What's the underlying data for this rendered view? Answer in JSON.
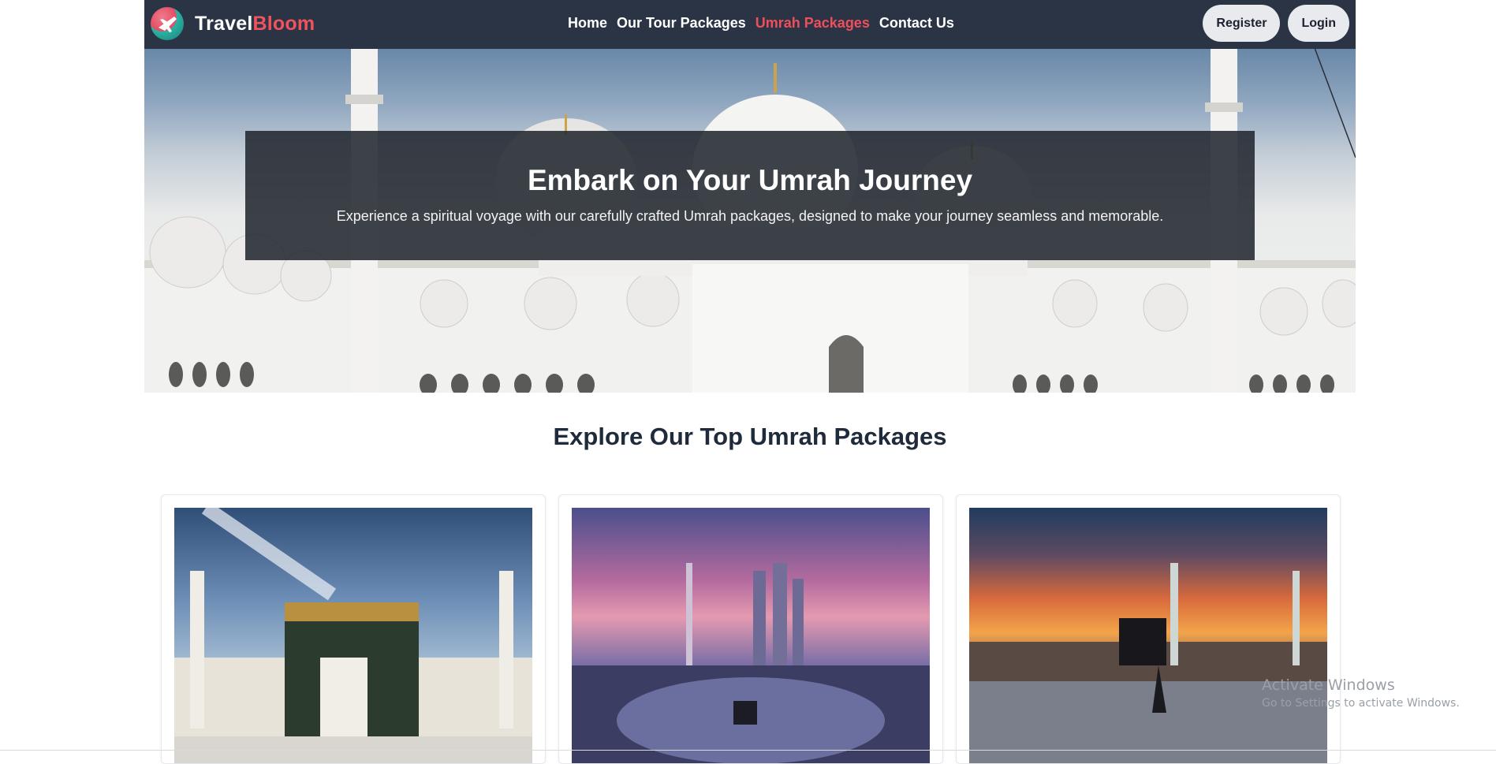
{
  "brand": {
    "part1": "Travel",
    "part2": "Bloom",
    "logo_icon": "plane-icon"
  },
  "nav": {
    "items": [
      {
        "label": "Home",
        "active": false
      },
      {
        "label": "Our Tour Packages",
        "active": false
      },
      {
        "label": "Umrah Packages",
        "active": true
      },
      {
        "label": "Contact Us",
        "active": false
      }
    ],
    "register_label": "Register",
    "login_label": "Login"
  },
  "hero": {
    "title": "Embark on Your Umrah Journey",
    "subtitle": "Experience a spiritual voyage with our carefully crafted Umrah packages, designed to make your journey seamless and memorable."
  },
  "packages": {
    "heading": "Explore Our Top Umrah Packages"
  },
  "watermark": {
    "title": "Activate Windows",
    "subtitle": "Go to Settings to activate Windows."
  },
  "colors": {
    "nav_bg": "#2a3444",
    "accent": "#ef4f5b",
    "heading": "#1f2a3a"
  }
}
